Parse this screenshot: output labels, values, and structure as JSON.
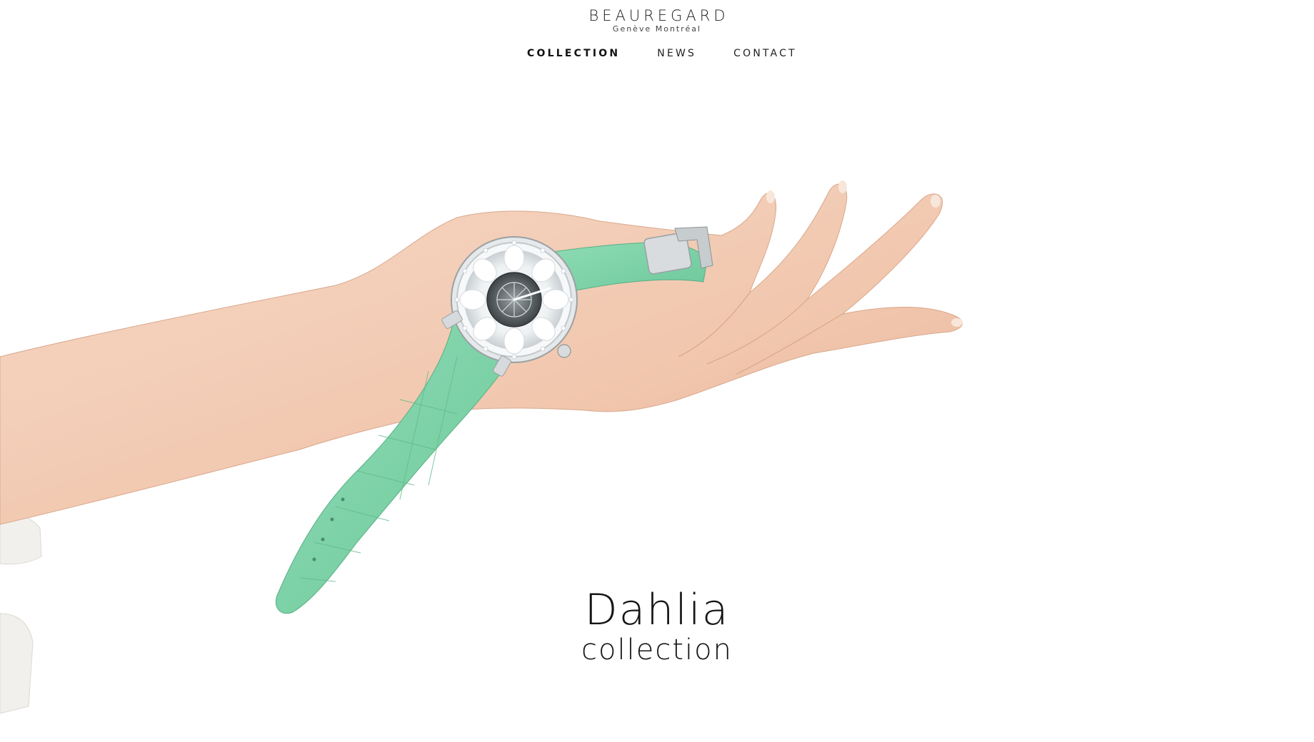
{
  "brand": {
    "name": "BEAUREGARD",
    "tagline": "Genève Montréal"
  },
  "nav": {
    "items": [
      {
        "label": "COLLECTION",
        "active": true
      },
      {
        "label": "NEWS",
        "active": false
      },
      {
        "label": "CONTACT",
        "active": false
      }
    ]
  },
  "hero": {
    "image": "hand-holding-watch-photo",
    "strap_color": "#7ad1a6",
    "skin_color": "#f3cdb7",
    "title": "Dahlia",
    "subtitle": "collection"
  }
}
